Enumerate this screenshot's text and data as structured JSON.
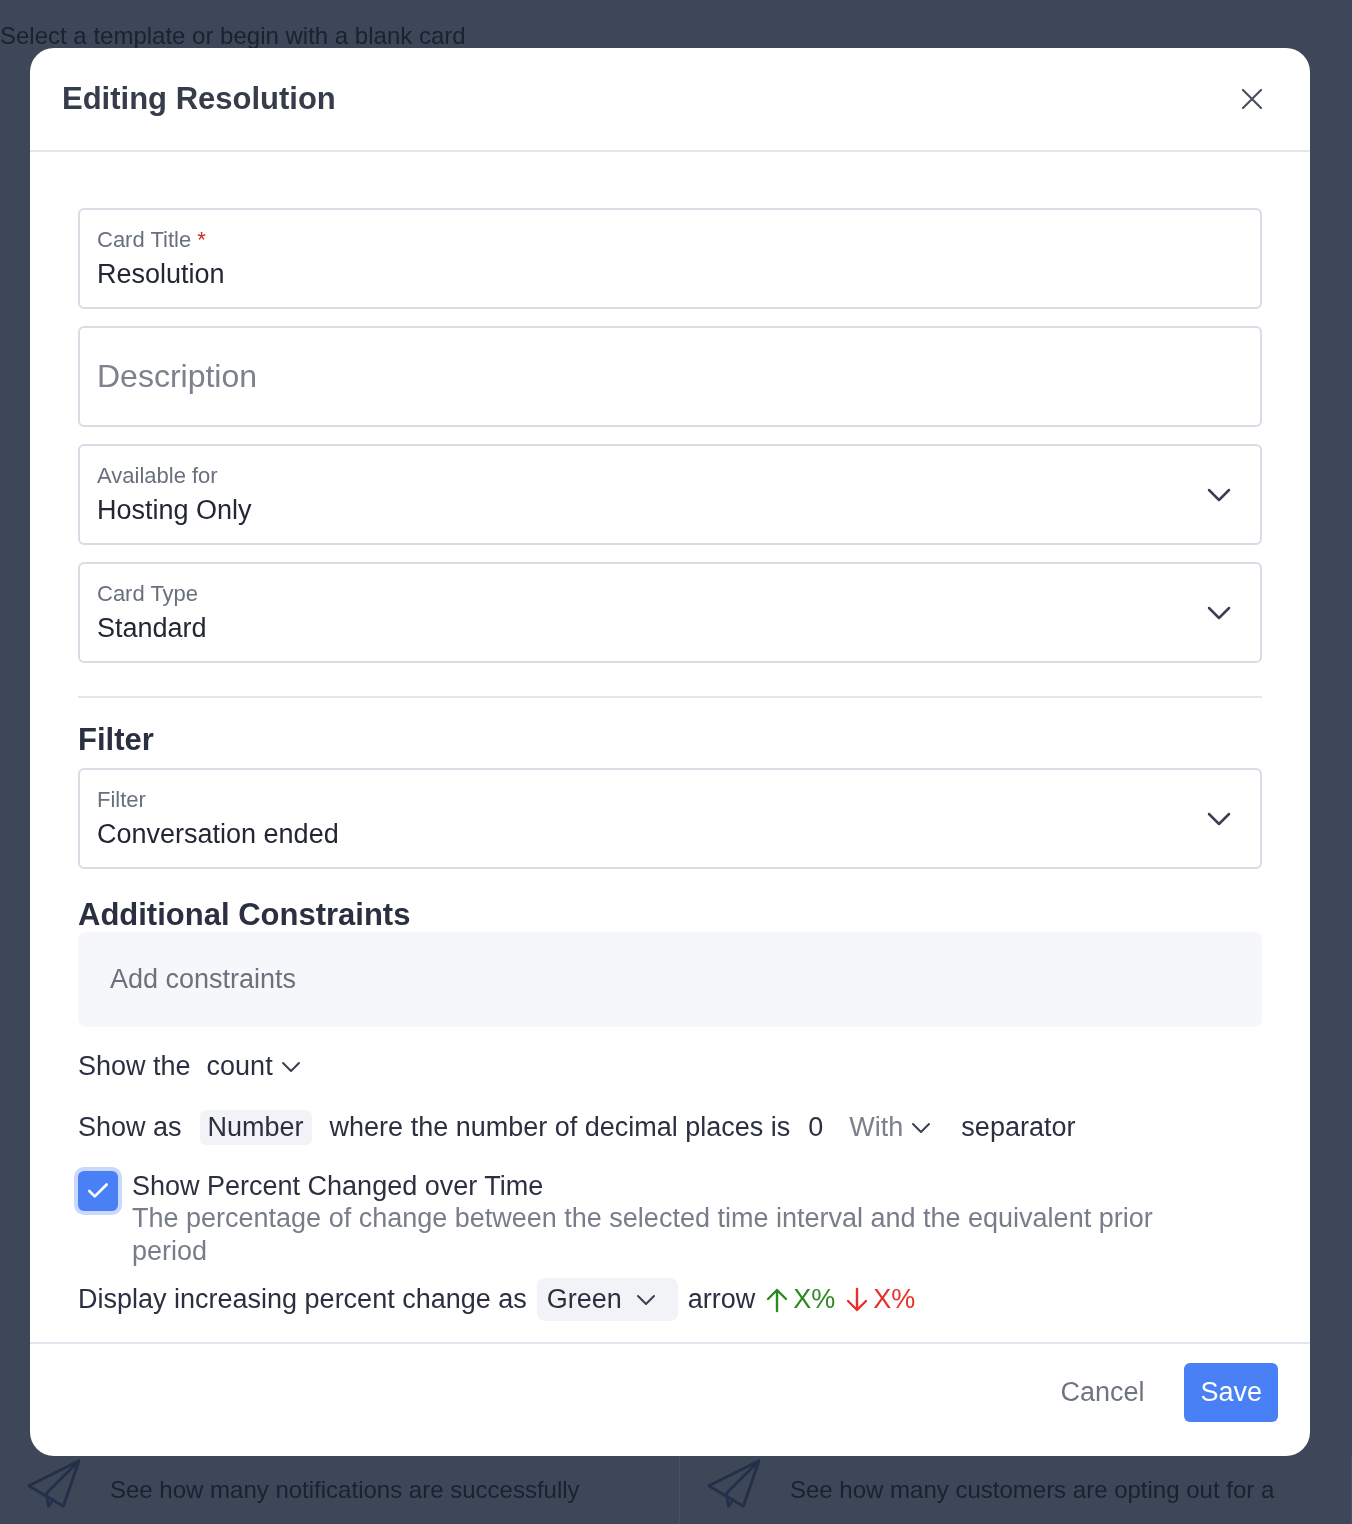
{
  "background": {
    "subtitle": "Select a template or begin with a blank card",
    "cards": [
      {
        "description": "See how many notifications are successfully"
      },
      {
        "description": "See how many customers are opting out for a"
      }
    ]
  },
  "dialog": {
    "title": "Editing Resolution",
    "fields": [
      {
        "kind": "text",
        "label": "Card Title",
        "required": true,
        "required_mark": "*",
        "value": "Resolution"
      },
      {
        "kind": "text",
        "placeholder": "Description"
      },
      {
        "kind": "select",
        "label": "Available for",
        "value": "Hosting Only"
      },
      {
        "kind": "select",
        "label": "Card Type",
        "value": "Standard"
      }
    ],
    "filter_section": {
      "heading": "Filter",
      "field": {
        "kind": "select",
        "label": "Filter",
        "value": "Conversation ended"
      }
    },
    "constraints": {
      "heading": "Additional Constraints",
      "placeholder": "Add constraints"
    },
    "show_row": {
      "prefix": "Show the",
      "metric": "count"
    },
    "format_row": {
      "prefix": "Show as",
      "format": "Number",
      "middle": "where the number of decimal places is",
      "decimals": "0",
      "separator_option": "With",
      "suffix": "separator"
    },
    "percent_change": {
      "checked": true,
      "label": "Show Percent Changed over Time",
      "description": "The percentage of change between the selected time interval and the equivalent prior period"
    },
    "color_row": {
      "prefix": "Display increasing percent change as",
      "color_option": "Green",
      "middle": "arrow",
      "up_text": "X%",
      "down_text": "X%"
    },
    "buttons": [
      {
        "kind": "secondary",
        "label": "Cancel"
      },
      {
        "kind": "primary",
        "label": "Save"
      }
    ]
  }
}
